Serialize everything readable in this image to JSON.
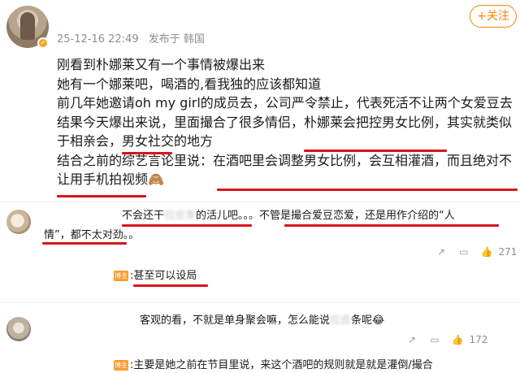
{
  "post": {
    "timestamp": "25-12-16 22:49",
    "source": "发布于 韩国",
    "follow_label": "+关注",
    "lines": [
      "刚看到朴娜莱又有一个事情被爆出来",
      "她有一个娜莱吧，喝酒的,看我独的应该都知道",
      "前几年她邀请oh my girl的成员去，公司严令禁止，代表死活不让两个女爱豆去",
      "结果今天爆出来说，里面撮合了很多情侣，朴娜莱会把控男女比例，其实就类似",
      "于相亲会，男女社交的地方",
      "结合之前的综艺言论里说：在酒吧里会调整男女比例，会互相灌酒，而且绝对不",
      "让用手机拍视频🙈"
    ]
  },
  "comments": [
    {
      "line1_a": "不会还干",
      "line1_blur": "拉皮条",
      "line1_b": "的活儿吧。。。不管是撮合爱豆恋爱，还是用作介绍的“人",
      "line2": "情”，都不太对劲。。",
      "actions": {
        "like_count": "271"
      },
      "reply": {
        "badge": "博主",
        "text": ":甚至可以设局"
      }
    },
    {
      "line1_a": "客观的看，不就是单身聚会嘛，怎么能说",
      "line1_blur": "拉皮",
      "line1_b": "条呢😂",
      "actions": {
        "like_count": "172"
      },
      "reply": {
        "badge": "博主",
        "text": ":主要是她之前在节目里说，来这个酒吧的规则就是就是灌倒/撮合"
      }
    }
  ],
  "icons": {
    "share": "share-icon",
    "comment": "comment-icon",
    "like": "like-icon",
    "verified": "verified-badge-icon"
  },
  "colors": {
    "highlight_underline": "#d6151c",
    "follow": "#ff8200",
    "badge": "#ff9a2e"
  }
}
